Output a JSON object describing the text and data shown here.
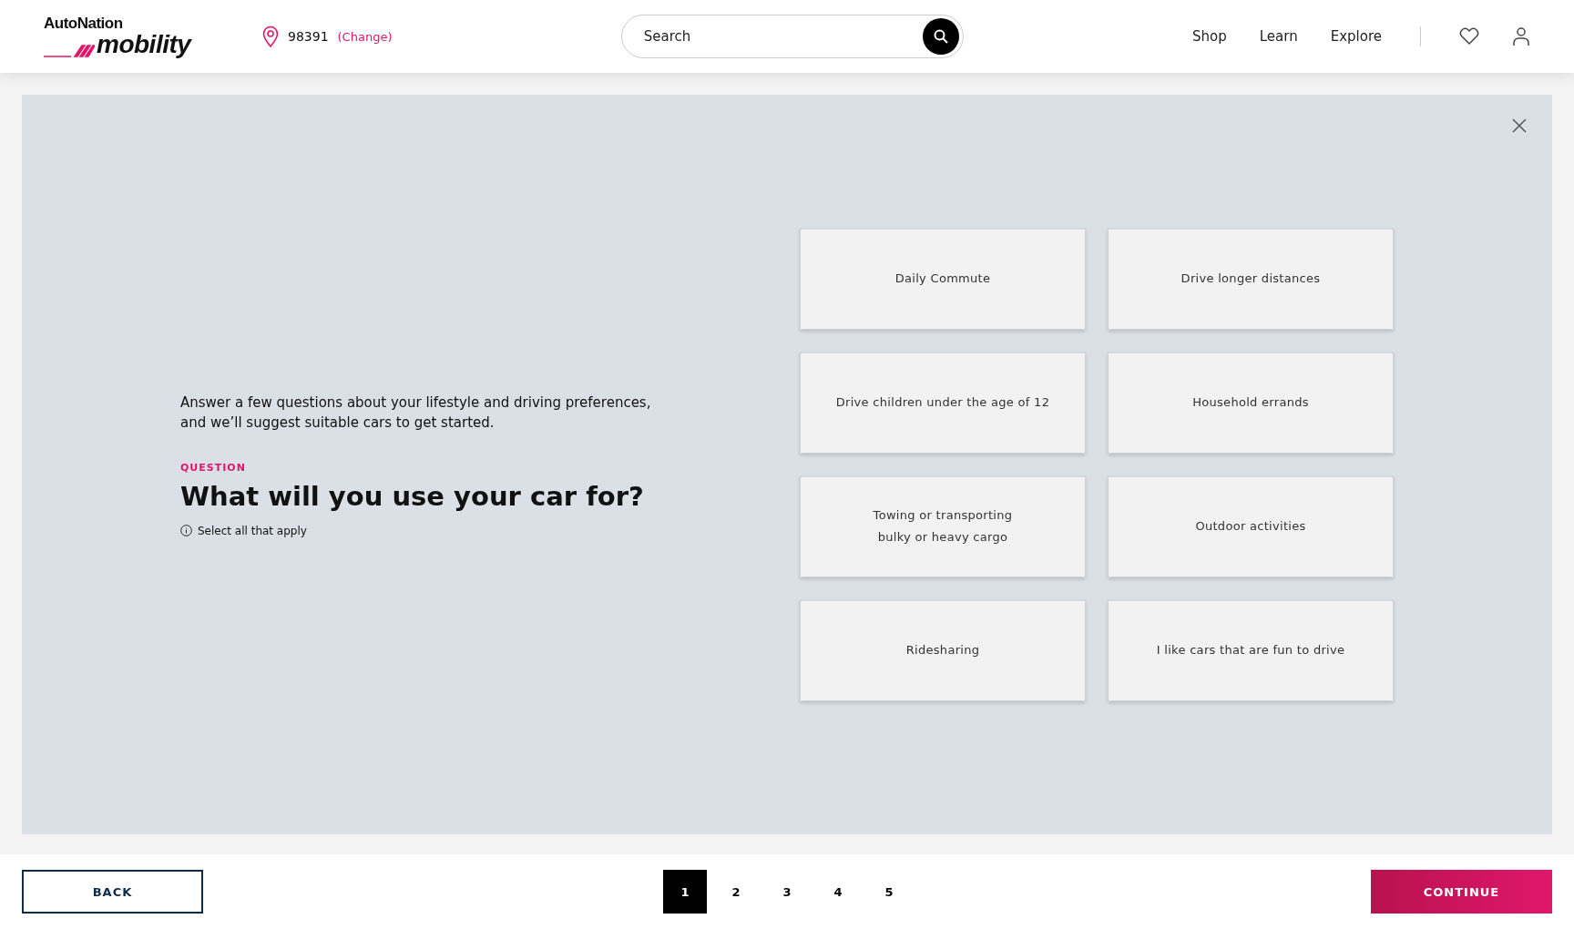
{
  "header": {
    "logo": {
      "top": "AutoNation",
      "bottom": "mobility"
    },
    "location": {
      "zip": "98391",
      "change": "(Change)"
    },
    "search": {
      "placeholder": "Search"
    },
    "nav": [
      "Shop",
      "Learn",
      "Explore"
    ]
  },
  "intro": "Answer a few questions about your lifestyle and driving preferences, and we’ll suggest suitable cars to get started.",
  "question": {
    "eyebrow": "QUESTION",
    "title": "What will you use your car for?",
    "hint": "Select all that apply"
  },
  "options": [
    {
      "label": "Daily Commute",
      "selected": false
    },
    {
      "label": "Drive longer distances",
      "selected": false
    },
    {
      "label": "Drive children under the age of 12",
      "selected": false
    },
    {
      "label": "Household errands",
      "selected": false
    },
    {
      "label": "Towing or transporting\nbulky or heavy cargo",
      "selected": false
    },
    {
      "label": "Outdoor activities",
      "selected": false
    },
    {
      "label": "Ridesharing",
      "selected": false
    },
    {
      "label": "I like cars that are fun to drive",
      "selected": false
    }
  ],
  "footer": {
    "back": "BACK",
    "pages": [
      {
        "label": "1",
        "selected": true
      },
      {
        "label": "2",
        "selected": false
      },
      {
        "label": "3",
        "selected": false
      },
      {
        "label": "4",
        "selected": false
      },
      {
        "label": "5",
        "selected": false
      }
    ],
    "continue": "CONTINUE"
  }
}
